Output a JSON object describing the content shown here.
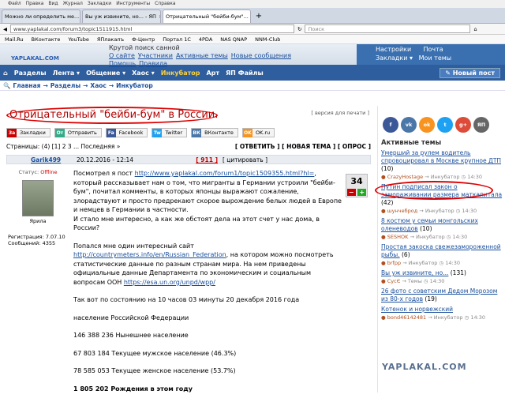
{
  "menu": [
    "Файл",
    "Правка",
    "Вид",
    "Журнал",
    "Закладки",
    "Инструменты",
    "Справка"
  ],
  "tabs": [
    {
      "label": "Можно ли определить ме..."
    },
    {
      "label": "Вы уж извините, но... - ЯП"
    },
    {
      "label": "Отрицательный \"бейби-бум\"..."
    }
  ],
  "url": "www.yaplakal.com/forum3/topic1511915.html",
  "search_placeholder": "Поиск",
  "bookmarks": [
    "Mail.Ru",
    "ВКонтакте",
    "YouTube",
    "ЯПлакалъ",
    "Ф-Центр",
    "Портал 1С",
    "4PDA",
    "NAS QNAP",
    "NNM-Club"
  ],
  "site": {
    "logo": "YAPLAKAL.COM",
    "tagline": "Крутой поиск санной",
    "links1": [
      "О сайте",
      "Участники",
      "Активные темы",
      "Новые сообщения"
    ],
    "links2": [
      "Помощь",
      "Правила"
    ],
    "right1": [
      "Настройки",
      "Почта"
    ],
    "right2": [
      "Закладки",
      "Мои темы"
    ]
  },
  "nav": {
    "items": [
      "Разделы",
      "Лента",
      "Общение",
      "Хаос"
    ],
    "highlight": "Инкубатор",
    "items2": [
      "Арт",
      "ЯП Файлы"
    ],
    "newpost": "Новый пост"
  },
  "breadcrumb": [
    "Главная",
    "Разделы",
    "Хаос",
    "Инкубатор"
  ],
  "post": {
    "title": "Отрицательный \"бейби-бум\" в России.",
    "print": "[ версия для печати ]",
    "share": [
      {
        "label": "Закладки",
        "color": "#c00"
      },
      {
        "label": "Отправить",
        "color": "#3a8"
      },
      {
        "label": "Facebook",
        "color": "#3b5998"
      },
      {
        "label": "Twitter",
        "color": "#1da1f2"
      },
      {
        "label": "ВКонтакте",
        "color": "#4a76a8"
      },
      {
        "label": "OK.ru",
        "color": "#f7931e"
      }
    ],
    "pages": "Страницы: (4) [1] 2 3 ... Последняя »",
    "actions": "[ ОТВЕТИТЬ ] [ НОВАЯ ТЕМА ] [ ОПРОС ]",
    "author": "Garik499",
    "date": "20.12.2016 - 12:14",
    "num": "[ 911 ]",
    "quote": "[ цитировать ]",
    "status": "Статус: Offline",
    "rank": "Ярила",
    "reg": "Регистрация: 7.07.10",
    "msgs": "Сообщений: 4355",
    "rating": "34",
    "p1a": "Посмотрел я пост ",
    "p1link": "http://www.yaplakal.com/forum1/topic1509355.html?hl=",
    "p1b": ", который рассказывает нам о том, что мигранты в Германии устроили \"бейби-бум\", почитал комменты, в которых японцы выражают сожаление, злорадствуют и просто предрекают скорое вырождение белых людей в Европе и немцев в Германии в частности.",
    "p1c": "И стало мне интересно, а как же обстоят дела на этот счет у нас дома, в России?",
    "p2a": "Попался мне один интересный сайт ",
    "p2link": "http://countrymeters.info/en/Russian_Federation",
    "p2b": ", на котором можно посмотреть статистические данные по разным странам мира. На нем приведены официальные данные Департамента по экономическим и социальным вопросам ООН ",
    "p2link2": "https://esa.un.org/unpd/wpp/",
    "p3": "Так вот по состоянию на 10 часов 03 минуты 20 декабря 2016 года",
    "p4": "население Российской Федерации",
    "p5": "146 388 236 Нынешнее население",
    "p6": "67 803 184 Текущее мужское население (46.3%)",
    "p7": "78 585 053 Текущее женское население (53.7%)",
    "p8": "1 805 202 Рождения в этом году"
  },
  "sidebar": {
    "social": [
      {
        "t": "f",
        "c": "#3b5998"
      },
      {
        "t": "vk",
        "c": "#4a76a8"
      },
      {
        "t": "ok",
        "c": "#f7931e"
      },
      {
        "t": "t",
        "c": "#1da1f2"
      },
      {
        "t": "g+",
        "c": "#dd4b39"
      },
      {
        "t": "ЯП",
        "c": "#666"
      }
    ],
    "heading": "Активные темы",
    "topics": [
      {
        "title": "Умерший за рулем водитель спровоцировал в Москве крупное ДТП",
        "count": "(10)",
        "user": "CrazyHostage",
        "section": "Инкубатор",
        "time": "14:30"
      },
      {
        "title": "Путин подписал закон о замораживании размера маткапитала",
        "count": "(42)",
        "user": "шунчеброд",
        "section": "Инкубатор",
        "time": "14:30"
      },
      {
        "title": "8 костюм у семьи монгольских оленеводов",
        "count": "(10)",
        "user": "SESHOK",
        "section": "Инкубатор",
        "time": "14:30"
      },
      {
        "title": "Простая закоска свежезамороженной рыбы.",
        "count": "(6)",
        "user": "brfpp",
        "section": "Инкубатор",
        "time": "14:30"
      },
      {
        "title": "Вы уж извините, но...",
        "count": "(131)",
        "user": "СусЄ",
        "section": "Темы",
        "time": "14:30"
      },
      {
        "title": "26 фото с советским Дедом Морозом из 80-х годов",
        "count": "(19)",
        "user": "",
        "section": "",
        "time": ""
      },
      {
        "title": "Котенок и норвежский",
        "count": "",
        "user": "bond46142481",
        "section": "Инкубатор",
        "time": "14:30"
      }
    ]
  },
  "watermark": "YAPLAKAL.COM"
}
